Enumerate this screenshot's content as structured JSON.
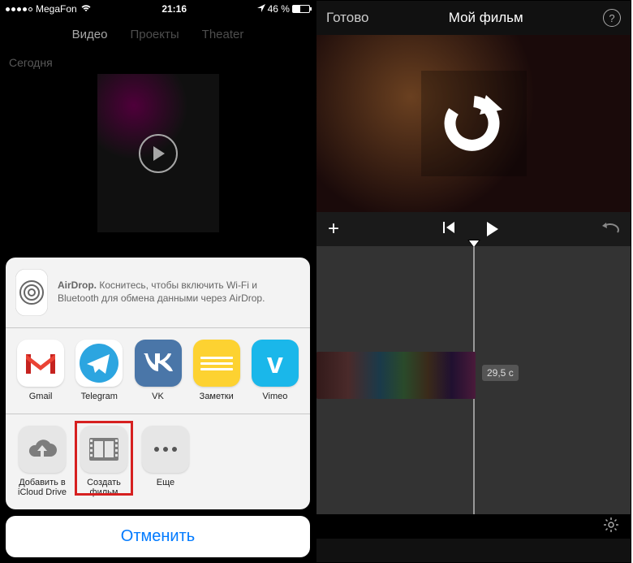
{
  "left": {
    "status": {
      "carrier": "MegaFon",
      "time": "21:16",
      "battery_pct": "46 %"
    },
    "tabs": {
      "video": "Видео",
      "projects": "Проекты",
      "theater": "Theater"
    },
    "section_today": "Сегодня",
    "airdrop": {
      "title": "AirDrop.",
      "body": "Коснитесь, чтобы включить Wi-Fi и Bluetooth для обмена данными через AirDrop."
    },
    "apps": {
      "gmail": "Gmail",
      "telegram": "Telegram",
      "vk": "VK",
      "notes": "Заметки",
      "vimeo": "Vimeo"
    },
    "actions": {
      "icloud": "Добавить в iCloud Drive",
      "create_film": "Создать фильм",
      "more": "Еще"
    },
    "cancel": "Отменить"
  },
  "right": {
    "done": "Готово",
    "title": "Мой фильм",
    "time_label": "29,5 с"
  }
}
